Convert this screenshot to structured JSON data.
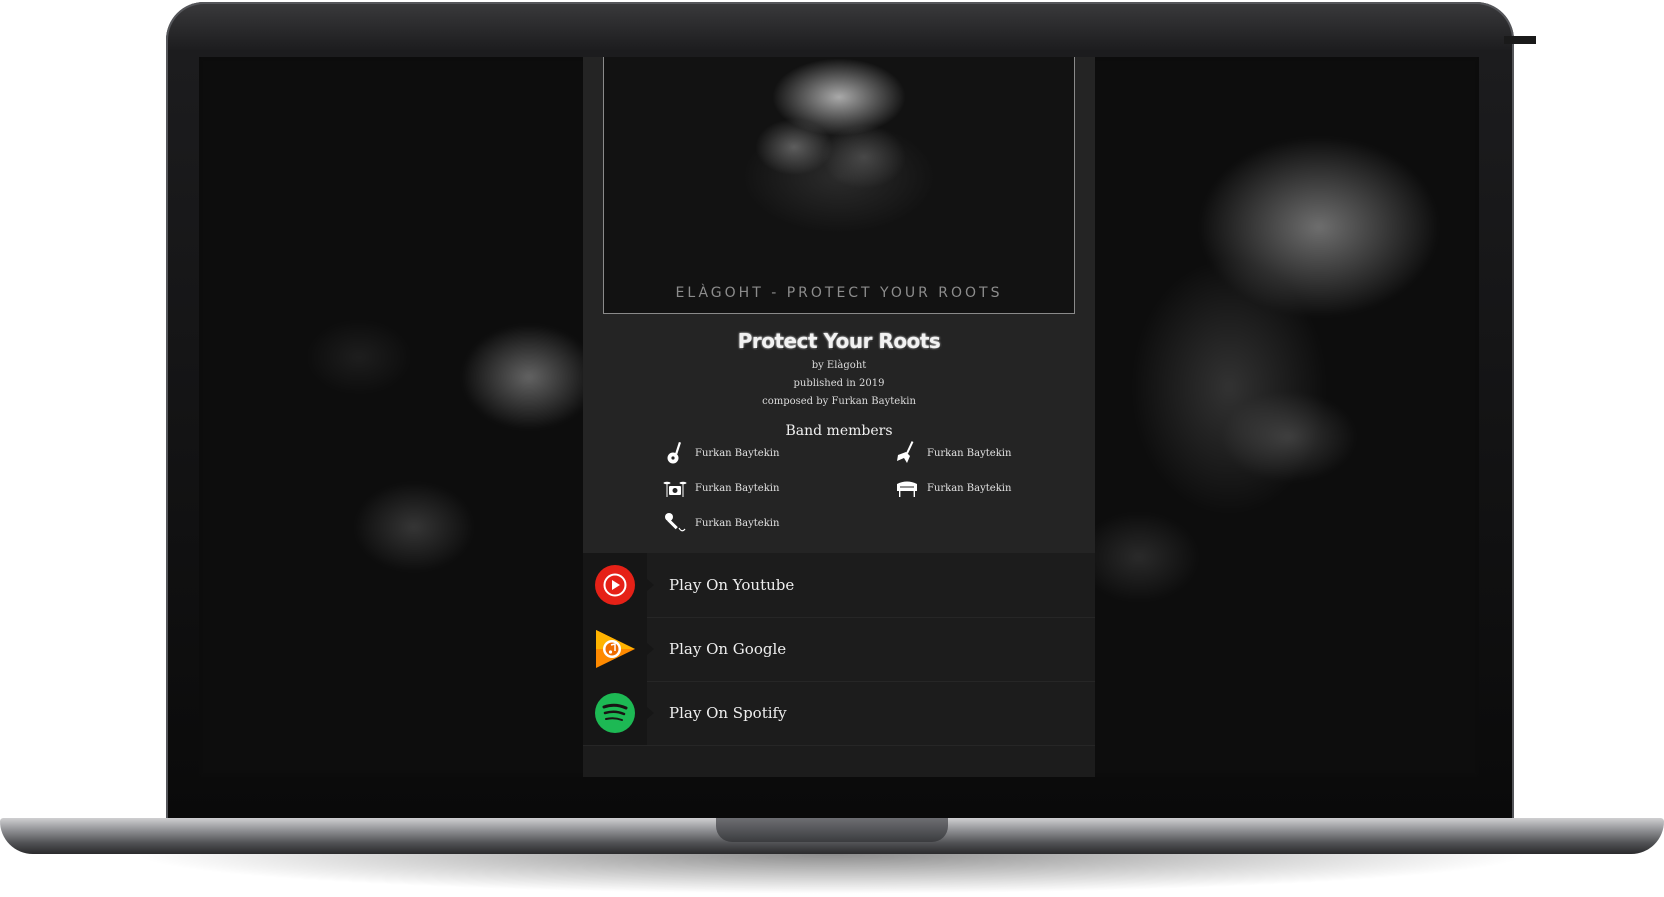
{
  "album": {
    "cover_caption": "ELÀGOHT - PROTECT YOUR ROOTS",
    "title": "Protect Your Roots",
    "by": "by Elàgoht",
    "published": "published in 2019",
    "composed": "composed by Furkan Baytekin"
  },
  "band": {
    "heading": "Band members",
    "members": [
      {
        "name": "Furkan Baytekin",
        "icon": "guitar-icon"
      },
      {
        "name": "Furkan Baytekin",
        "icon": "electric-guitar-icon"
      },
      {
        "name": "Furkan Baytekin",
        "icon": "drums-icon"
      },
      {
        "name": "Furkan Baytekin",
        "icon": "piano-icon"
      },
      {
        "name": "Furkan Baytekin",
        "icon": "microphone-icon"
      }
    ]
  },
  "links": [
    {
      "label": "Play On Youtube",
      "icon": "youtube-music-icon",
      "color": "#e62117"
    },
    {
      "label": "Play On Google",
      "icon": "google-play-music-icon",
      "color": "#ff8a00"
    },
    {
      "label": "Play On Spotify",
      "icon": "spotify-icon",
      "color": "#1db954"
    }
  ],
  "colors": {
    "panel": "#242424",
    "links_bg": "#1c1c1c",
    "text": "#eeeeee"
  }
}
